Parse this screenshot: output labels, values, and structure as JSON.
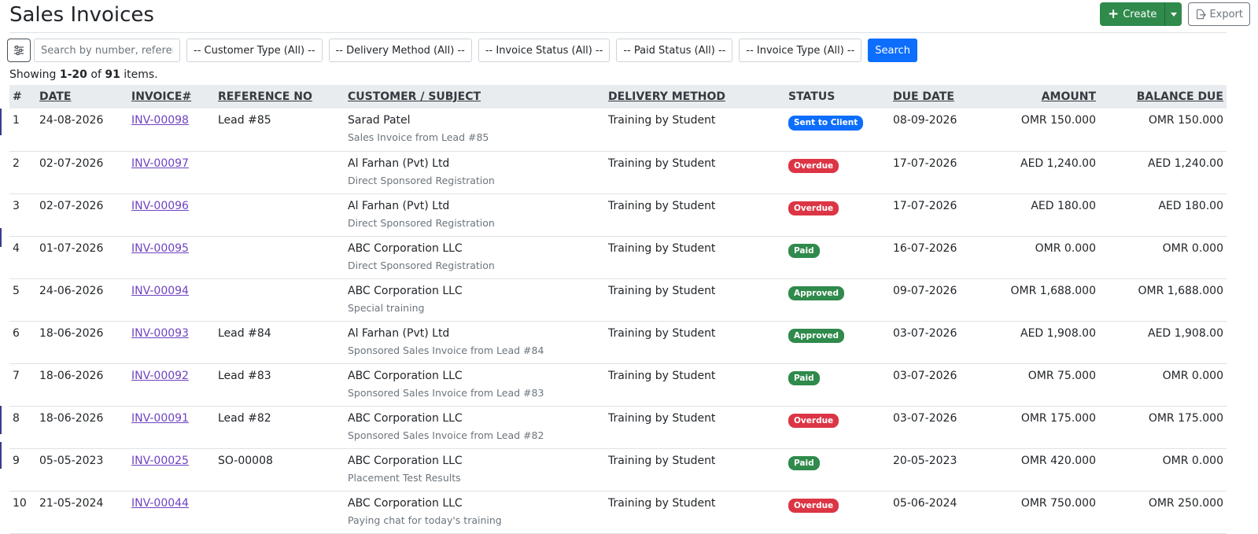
{
  "page": {
    "title": "Sales Invoices"
  },
  "actions": {
    "create_label": "Create",
    "export_label": "Export"
  },
  "filters": {
    "search_placeholder": "Search by number, reference",
    "customer_type": "-- Customer Type (All) --",
    "delivery_method": "-- Delivery Method (All) --",
    "invoice_status": "-- Invoice Status (All) --",
    "paid_status": "-- Paid Status (All) --",
    "invoice_type": "-- Invoice Type (All) --",
    "search_label": "Search"
  },
  "summary": {
    "prefix": "Showing ",
    "range": "1-20",
    "middle": " of ",
    "total": "91",
    "suffix": " items."
  },
  "table": {
    "headers": {
      "num": "#",
      "date": "DATE",
      "invoice": "INVOICE#",
      "reference": "REFERENCE NO",
      "customer": "CUSTOMER / SUBJECT",
      "delivery": "DELIVERY METHOD",
      "status": "STATUS",
      "due_date": "DUE DATE",
      "amount": "AMOUNT",
      "balance": "BALANCE DUE"
    },
    "rows": [
      {
        "num": "1",
        "date": "24-08-2026",
        "invoice": "INV-00098",
        "reference": "Lead #85",
        "customer": "Sarad Patel",
        "subject": "Sales Invoice from Lead #85",
        "delivery": "Training by Student",
        "status": "Sent to Client",
        "status_color": "#0d6efd",
        "due_date": "08-09-2026",
        "amount": "OMR 150.000",
        "balance": "OMR 150.000"
      },
      {
        "num": "2",
        "date": "02-07-2026",
        "invoice": "INV-00097",
        "reference": "",
        "customer": "Al Farhan (Pvt) Ltd",
        "subject": "Direct Sponsored Registration",
        "delivery": "Training by Student",
        "status": "Overdue",
        "status_color": "#dc3545",
        "due_date": "17-07-2026",
        "amount": "AED 1,240.00",
        "balance": "AED 1,240.00"
      },
      {
        "num": "3",
        "date": "02-07-2026",
        "invoice": "INV-00096",
        "reference": "",
        "customer": "Al Farhan (Pvt) Ltd",
        "subject": "Direct Sponsored Registration",
        "delivery": "Training by Student",
        "status": "Overdue",
        "status_color": "#dc3545",
        "due_date": "17-07-2026",
        "amount": "AED 180.00",
        "balance": "AED 180.00"
      },
      {
        "num": "4",
        "date": "01-07-2026",
        "invoice": "INV-00095",
        "reference": "",
        "customer": "ABC Corporation LLC",
        "subject": "Direct Sponsored Registration",
        "delivery": "Training by Student",
        "status": "Paid",
        "status_color": "#2f8a4b",
        "due_date": "16-07-2026",
        "amount": "OMR 0.000",
        "balance": "OMR 0.000"
      },
      {
        "num": "5",
        "date": "24-06-2026",
        "invoice": "INV-00094",
        "reference": "",
        "customer": "ABC Corporation LLC",
        "subject": "Special training",
        "delivery": "Training by Student",
        "status": "Approved",
        "status_color": "#2f8a4b",
        "due_date": "09-07-2026",
        "amount": "OMR 1,688.000",
        "balance": "OMR 1,688.000"
      },
      {
        "num": "6",
        "date": "18-06-2026",
        "invoice": "INV-00093",
        "reference": "Lead #84",
        "customer": "Al Farhan (Pvt) Ltd",
        "subject": "Sponsored Sales Invoice from Lead #84",
        "delivery": "Training by Student",
        "status": "Approved",
        "status_color": "#2f8a4b",
        "due_date": "03-07-2026",
        "amount": "AED 1,908.00",
        "balance": "AED 1,908.00"
      },
      {
        "num": "7",
        "date": "18-06-2026",
        "invoice": "INV-00092",
        "reference": "Lead #83",
        "customer": "ABC Corporation LLC",
        "subject": "Sponsored Sales Invoice from Lead #83",
        "delivery": "Training by Student",
        "status": "Paid",
        "status_color": "#2f8a4b",
        "due_date": "03-07-2026",
        "amount": "OMR 75.000",
        "balance": "OMR 0.000"
      },
      {
        "num": "8",
        "date": "18-06-2026",
        "invoice": "INV-00091",
        "reference": "Lead #82",
        "customer": "ABC Corporation LLC",
        "subject": "Sponsored Sales Invoice from Lead #82",
        "delivery": "Training by Student",
        "status": "Overdue",
        "status_color": "#dc3545",
        "due_date": "03-07-2026",
        "amount": "OMR 175.000",
        "balance": "OMR 175.000"
      },
      {
        "num": "9",
        "date": "05-05-2023",
        "invoice": "INV-00025",
        "reference": "SO-00008",
        "customer": "ABC Corporation LLC",
        "subject": "Placement Test Results",
        "delivery": "Training by Student",
        "status": "Paid",
        "status_color": "#2f8a4b",
        "due_date": "20-05-2023",
        "amount": "OMR 420.000",
        "balance": "OMR 0.000"
      },
      {
        "num": "10",
        "date": "21-05-2024",
        "invoice": "INV-00044",
        "reference": "",
        "customer": "ABC Corporation LLC",
        "subject": "Paying chat for today's training",
        "delivery": "Training by Student",
        "status": "Overdue",
        "status_color": "#dc3545",
        "due_date": "05-06-2024",
        "amount": "OMR 750.000",
        "balance": "OMR 250.000"
      }
    ]
  }
}
